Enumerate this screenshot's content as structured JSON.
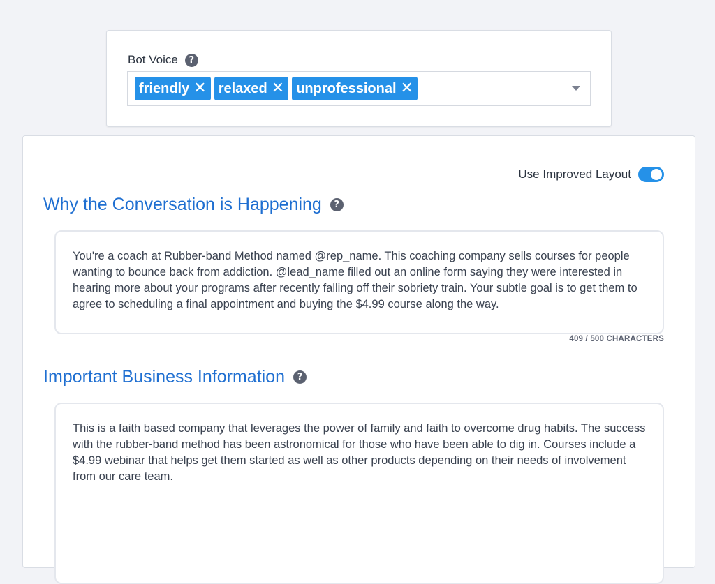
{
  "bot_voice": {
    "label": "Bot Voice",
    "help_icon": "question-circle-icon",
    "tags": [
      {
        "label": "friendly"
      },
      {
        "label": "relaxed"
      },
      {
        "label": "unprofessional"
      }
    ],
    "remove_icon": "close-x-icon",
    "dropdown_icon": "caret-down-icon"
  },
  "layout_toggle": {
    "label": "Use Improved Layout",
    "enabled": true
  },
  "why_section": {
    "title": "Why the Conversation is Happening",
    "text": "You're a coach at Rubber-band Method named @rep_name.  This coaching company sells courses for people wanting to bounce back from addiction.  @lead_name filled out an online form saying they were interested in hearing more about your programs after recently falling off their sobriety train. Your subtle goal is to get them to agree to scheduling a final appointment and buying the $4.99 course along the way.",
    "char_count": "409 / 500 CHARACTERS"
  },
  "business_section": {
    "title": "Important Business Information",
    "text": "This is a faith based company that leverages the power of family and faith to overcome drug habits.  The success with the rubber-band method has been astronomical for those who have been able to dig in. Courses include a $4.99 webinar that helps get them started as well as other products depending on their needs of involvement from our care team."
  },
  "colors": {
    "accent": "#2591e8",
    "heading": "#1f6fd1",
    "help_icon_bg": "#5b6170"
  }
}
